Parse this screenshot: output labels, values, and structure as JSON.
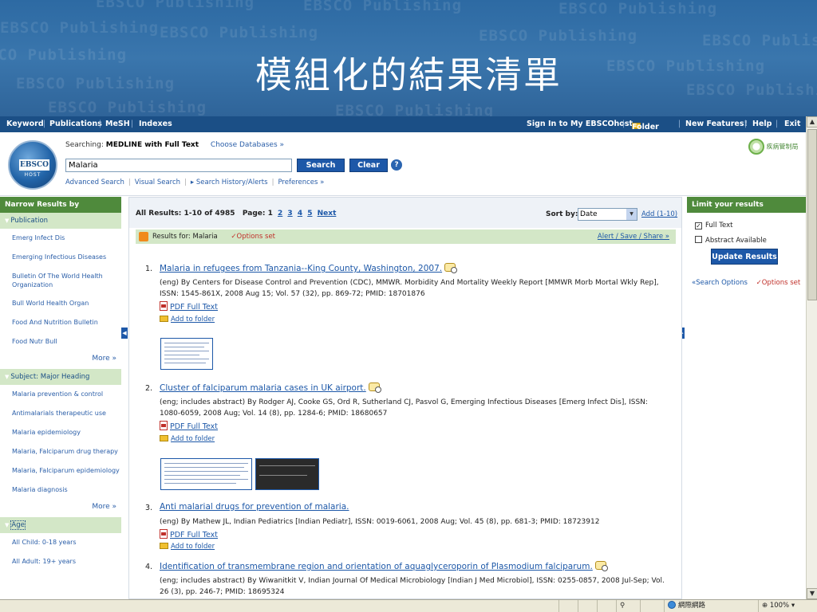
{
  "slide": {
    "title": "模組化的結果清單",
    "watermark": "EBSCO Publishing"
  },
  "topnav": {
    "left": [
      "Keyword",
      "Publications",
      "MeSH",
      "Indexes"
    ],
    "signin": "Sign In to My EBSCOhost",
    "folder": "Folder",
    "new_features": "New Features!",
    "help": "Help",
    "exit": "Exit"
  },
  "header": {
    "logo_text": "EBSCO",
    "logo_sub": "HOST",
    "searching_label": "Searching:",
    "database": "MEDLINE with Full Text",
    "choose_databases": "Choose Databases »",
    "search_value": "Malaria",
    "search_button": "Search",
    "clear_button": "Clear",
    "help_icon": "?",
    "links": [
      "Advanced Search",
      "Visual Search",
      "▸ Search History/Alerts",
      "Preferences »"
    ],
    "partner_logo": "疾病管制局"
  },
  "left_sidebar": {
    "heading": "Narrow Results by",
    "facets": [
      {
        "label": "Publication",
        "items": [
          "Emerg Infect Dis",
          "Emerging Infectious Diseases",
          "Bulletin Of The World Health Organization",
          "Bull World Health Organ",
          "Food And Nutrition Bulletin",
          "Food Nutr Bull"
        ],
        "more": "More »"
      },
      {
        "label": "Subject: Major Heading",
        "items": [
          "Malaria prevention & control",
          "Antimalarials therapeutic use",
          "Malaria epidemiology",
          "Malaria, Falciparum drug therapy",
          "Malaria, Falciparum epidemiology",
          "Malaria diagnosis"
        ],
        "more": "More »"
      },
      {
        "label": "Age",
        "items": [
          "All Child: 0-18 years",
          "All Adult: 19+ years"
        ]
      }
    ]
  },
  "results": {
    "summary": "All Results: 1-10 of 4985",
    "page_label": "Page: 1",
    "pages": [
      "2",
      "3",
      "4",
      "5"
    ],
    "next": "Next",
    "sort_label": "Sort by:",
    "sort_value": "Date",
    "add_range": "Add (1-10)",
    "results_for_label": "Results for:",
    "results_for_query": "Malaria",
    "options_set": "✓Options set",
    "alert_save_share": "Alert / Save / Share »",
    "items": [
      {
        "num": "1.",
        "title": "Malaria in refugees from Tanzania--King County, Washington, 2007.",
        "meta": "(eng) By Centers for Disease Control and Prevention (CDC), MMWR. Morbidity And Mortality Weekly Report [MMWR Morb Mortal Wkly Rep], ISSN: 1545-861X, 2008 Aug 15; Vol. 57 (32), pp. 869-72; PMID: 18701876",
        "pdf": "PDF Full Text",
        "folder": "Add to folder"
      },
      {
        "num": "2.",
        "title": "Cluster of falciparum malaria cases in UK airport.",
        "meta": "(eng; includes abstract) By Rodger AJ, Cooke GS, Ord R, Sutherland CJ, Pasvol G, Emerging Infectious Diseases [Emerg Infect Dis], ISSN: 1080-6059, 2008 Aug; Vol. 14 (8), pp. 1284-6; PMID: 18680657",
        "pdf": "PDF Full Text",
        "folder": "Add to folder"
      },
      {
        "num": "3.",
        "title": "Anti malarial drugs for prevention of malaria.",
        "meta": "(eng) By Mathew JL, Indian Pediatrics [Indian Pediatr], ISSN: 0019-6061, 2008 Aug; Vol. 45 (8), pp. 681-3; PMID: 18723912",
        "pdf": "PDF Full Text",
        "folder": "Add to folder"
      },
      {
        "num": "4.",
        "title": "Identification of transmembrane region and orientation of aquaglyceroporin of Plasmodium falciparum.",
        "meta": "(eng; includes abstract) By Wiwanitkit V, Indian Journal Of Medical Microbiology [Indian J Med Microbiol], ISSN: 0255-0857, 2008 Jul-Sep; Vol. 26 (3), pp. 246-7; PMID: 18695324"
      }
    ]
  },
  "right_sidebar": {
    "heading": "Limit your results",
    "full_text": "Full Text",
    "abstract_available": "Abstract Available",
    "update_button": "Update Results",
    "search_options": "«Search Options",
    "options_set": "✓Options set"
  },
  "statusbar": {
    "zone": "網際網路",
    "zoom": "100%"
  },
  "colors": {
    "nav_blue": "#1b4f86",
    "sidebar_green": "#4f8a3c",
    "facet_green": "#d3e7c7",
    "link_blue": "#1d58a8"
  }
}
